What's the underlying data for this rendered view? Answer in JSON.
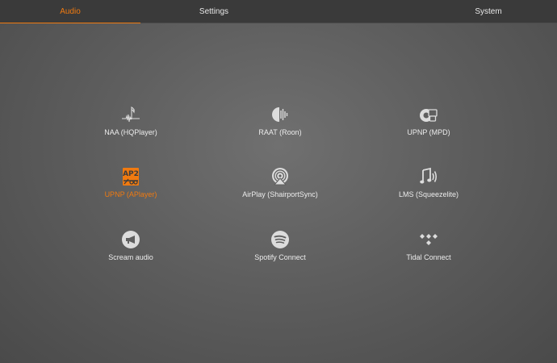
{
  "tabs": {
    "audio": "Audio",
    "settings": "Settings",
    "system": "System"
  },
  "accent_color": "#f07a10",
  "items": [
    {
      "label": "NAA (HQPlayer)",
      "icon": "waveform-note-icon"
    },
    {
      "label": "RAAT (Roon)",
      "icon": "roon-icon"
    },
    {
      "label": "UPNP (MPD)",
      "icon": "speaker-screen-icon"
    },
    {
      "label": "UPNP (APlayer)",
      "icon": "ap2-icon",
      "active": true
    },
    {
      "label": "AirPlay (ShairportSync)",
      "icon": "airplay-icon"
    },
    {
      "label": "LMS (Squeezelite)",
      "icon": "music-note-sound-icon"
    },
    {
      "label": "Scream audio",
      "icon": "megaphone-icon"
    },
    {
      "label": "Spotify Connect",
      "icon": "spotify-icon"
    },
    {
      "label": "Tidal Connect",
      "icon": "tidal-icon"
    }
  ]
}
